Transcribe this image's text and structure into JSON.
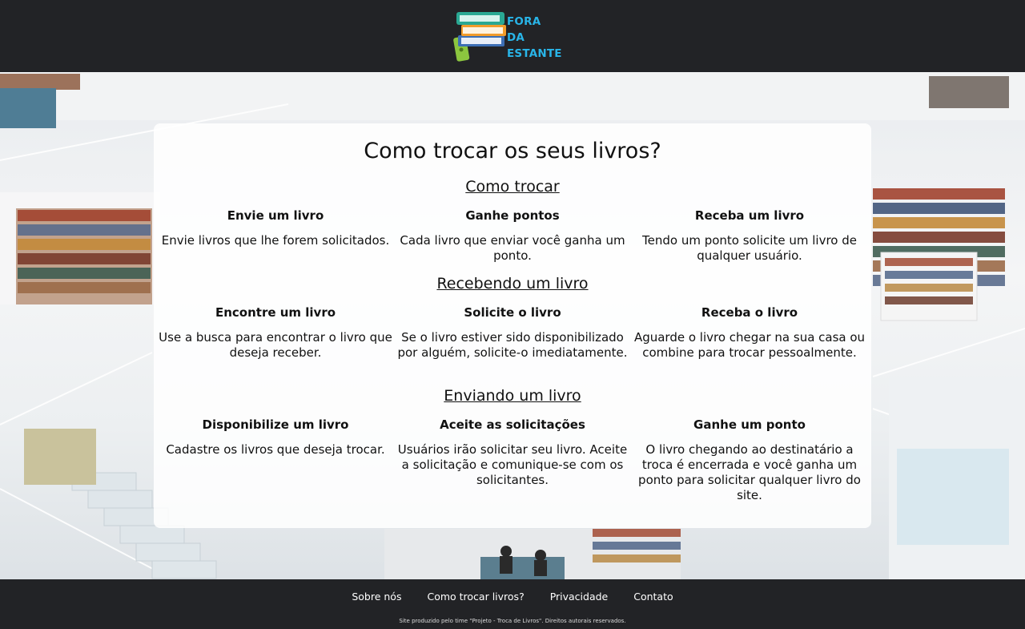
{
  "brand": {
    "line1": "FORA",
    "line2": "DA ESTANTE"
  },
  "page": {
    "title": "Como trocar os seus livros?"
  },
  "sections": [
    {
      "title": "Como trocar",
      "items": [
        {
          "heading": "Envie um livro",
          "text": "Envie livros que lhe forem solicitados."
        },
        {
          "heading": "Ganhe pontos",
          "text": "Cada livro que enviar você ganha um ponto."
        },
        {
          "heading": "Receba um livro",
          "text": "Tendo um ponto solicite um livro de qualquer usuário."
        }
      ]
    },
    {
      "title": "Recebendo um livro",
      "items": [
        {
          "heading": "Encontre um livro",
          "text": "Use a busca para encontrar o livro que deseja receber."
        },
        {
          "heading": "Solicite o livro",
          "text": "Se o livro estiver sido disponibilizado por alguém, solicite-o imediatamente."
        },
        {
          "heading": "Receba o livro",
          "text": "Aguarde o livro chegar na sua casa ou combine para trocar pessoalmente."
        }
      ]
    },
    {
      "title": "Enviando um livro",
      "items": [
        {
          "heading": "Disponibilize um livro",
          "text": "Cadastre os livros que deseja trocar."
        },
        {
          "heading": "Aceite as solicitações",
          "text": "Usuários irão solicitar seu livro. Aceite a solicitação e comunique-se com os solicitantes."
        },
        {
          "heading": "Ganhe um ponto",
          "text": "O livro chegando ao destinatário a troca é encerrada e você ganha um ponto para solicitar qualquer livro do site."
        }
      ]
    }
  ],
  "footer": {
    "links": [
      "Sobre nós",
      "Como trocar livros?",
      "Privacidade",
      "Contato"
    ],
    "copyright": "Site produzido pelo time \"Projeto - Troca de Livros\". Direitos autorais reservados."
  },
  "colors": {
    "header_bg": "#222326",
    "brand_text": "#29b5e8",
    "card_bg": "rgba(255,255,255,0.86)"
  }
}
